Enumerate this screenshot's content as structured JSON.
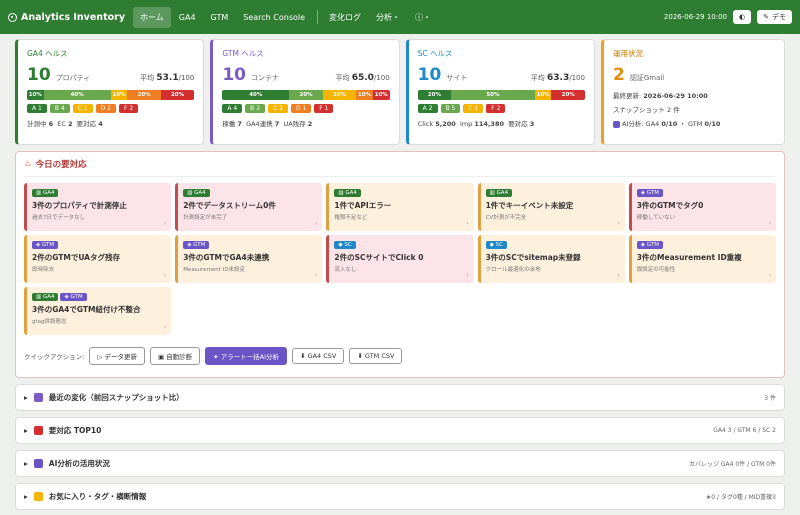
{
  "app": {
    "title": "Analytics Inventory",
    "nav": [
      "ホーム",
      "GA4",
      "GTM",
      "Search Console",
      "変化ログ",
      "分析・",
      "ⓘ・"
    ],
    "datetime": "2026-06-29 10:00",
    "demo": "デモ",
    "theme_icon": "◐"
  },
  "cards": [
    {
      "title": "GA4 ヘルス",
      "color": "#2e7d32",
      "count": "10",
      "unit": "プロパティ",
      "avg_label": "平均",
      "avg": "53.1",
      "avg_suffix": "/100",
      "bar": [
        {
          "label": "10%",
          "pct": 10,
          "color": "#2e7d32"
        },
        {
          "label": "40%",
          "pct": 40,
          "color": "#6aa84f"
        },
        {
          "label": "10%",
          "pct": 10,
          "color": "#f5b400"
        },
        {
          "label": "20%",
          "pct": 20,
          "color": "#ef7d22"
        },
        {
          "label": "20%",
          "pct": 20,
          "color": "#d32f2f"
        }
      ],
      "grades": [
        "A 1",
        "B 4",
        "C 1",
        "D 2",
        "F 2"
      ],
      "foot": [
        {
          "k": "計測中",
          "v": "6"
        },
        {
          "k": "EC",
          "v": "2"
        },
        {
          "k": "要対応",
          "v": "4"
        }
      ]
    },
    {
      "title": "GTM ヘルス",
      "color": "#7b5cc4",
      "count": "10",
      "unit": "コンテナ",
      "avg_label": "平均",
      "avg": "65.0",
      "avg_suffix": "/100",
      "bar": [
        {
          "label": "40%",
          "pct": 40,
          "color": "#2e7d32"
        },
        {
          "label": "20%",
          "pct": 20,
          "color": "#6aa84f"
        },
        {
          "label": "20%",
          "pct": 20,
          "color": "#f5b400"
        },
        {
          "label": "10%",
          "pct": 10,
          "color": "#ef7d22"
        },
        {
          "label": "10%",
          "pct": 10,
          "color": "#d32f2f"
        }
      ],
      "grades": [
        "A 4",
        "B 2",
        "C 2",
        "D 1",
        "F 1"
      ],
      "foot": [
        {
          "k": "稼働",
          "v": "7"
        },
        {
          "k": "GA4連携",
          "v": "7"
        },
        {
          "k": "UA残存",
          "v": "2"
        }
      ]
    },
    {
      "title": "SC ヘルス",
      "color": "#1e88c8",
      "count": "10",
      "unit": "サイト",
      "avg_label": "平均",
      "avg": "63.3",
      "avg_suffix": "/100",
      "bar": [
        {
          "label": "20%",
          "pct": 20,
          "color": "#2e7d32"
        },
        {
          "label": "50%",
          "pct": 50,
          "color": "#6aa84f"
        },
        {
          "label": "10%",
          "pct": 10,
          "color": "#f5b400"
        },
        {
          "label": "",
          "pct": 0,
          "color": "#ef7d22"
        },
        {
          "label": "20%",
          "pct": 20,
          "color": "#d32f2f"
        }
      ],
      "grades": [
        "A 2",
        "B 5",
        "C 1",
        "",
        "F 2"
      ],
      "foot": [
        {
          "k": "Click",
          "v": "5,200"
        },
        {
          "k": "Imp",
          "v": "114,380"
        },
        {
          "k": "要対応",
          "v": "3"
        }
      ]
    }
  ],
  "ops": {
    "title": "運用状況",
    "count": "2",
    "unit": "認証Gmail",
    "updated_label": "最終更新:",
    "updated": "2026-06-29 10:00",
    "snap": "スナップショット 2 件",
    "ai_label": "AI分析: GA4",
    "ai_ga4": "0/10",
    "ai_gtm_label": "GTM",
    "ai_gtm": "0/10"
  },
  "alerts": {
    "title": "今日の要対応",
    "items": [
      {
        "tags": [
          "GA4"
        ],
        "title": "3件のプロパティで計測停止",
        "sub": "過去7日でデータなし",
        "tone": "pink"
      },
      {
        "tags": [
          "GA4"
        ],
        "title": "2件でデータストリーム0件",
        "sub": "計測設定が未完了",
        "tone": "pink"
      },
      {
        "tags": [
          "GA4"
        ],
        "title": "1件でAPIエラー",
        "sub": "権限不足など",
        "tone": "orange"
      },
      {
        "tags": [
          "GA4"
        ],
        "title": "1件でキーイベント未設定",
        "sub": "CV計測が不完全",
        "tone": "orange"
      },
      {
        "tags": [
          "GTM"
        ],
        "title": "3件のGTMでタグ0",
        "sub": "稼働していない",
        "tone": "pink"
      },
      {
        "tags": [
          "GTM"
        ],
        "title": "2件のGTMでUAタグ残存",
        "sub": "即時除去",
        "tone": "orange"
      },
      {
        "tags": [
          "GTM"
        ],
        "title": "3件のGTMでGA4未連携",
        "sub": "Measurement ID未設定",
        "tone": "orange"
      },
      {
        "tags": [
          "SC"
        ],
        "title": "2件のSCサイトでClick 0",
        "sub": "流入なし",
        "tone": "pink"
      },
      {
        "tags": [
          "SC"
        ],
        "title": "3件のSCでsitemap未登録",
        "sub": "クロール最適化の余地",
        "tone": "orange"
      },
      {
        "tags": [
          "GTM"
        ],
        "title": "3件のMeasurement ID重複",
        "sub": "誤設定の可能性",
        "tone": "orange"
      },
      {
        "tags": [
          "GA4",
          "GTM"
        ],
        "title": "3件のGA4でGTM紐付け不整合",
        "sub": "gtag併設懸念",
        "tone": "orange"
      }
    ],
    "quick_label": "クイックアクション:",
    "actions": [
      "データ更新",
      "自動診断",
      "アラート一括AI分析",
      "GA4 CSV",
      "GTM CSV"
    ]
  },
  "sections": [
    {
      "title": "最近の変化（前回スナップショット比）",
      "right": "3 件",
      "icon": "#7b5cc4"
    },
    {
      "title": "要対応 TOP10",
      "right": "GA4 3 / GTM 6 / SC 2",
      "icon": "#d32f2f"
    },
    {
      "title": "AI分析の活用状況",
      "right": "カバレッジ GA4 0件 / GTM 0件",
      "icon": "#6a55c7"
    },
    {
      "title": "お気に入り・タグ・横断情報",
      "right": "★0 / タグ0種 / MID重複3",
      "icon": "#f5b400"
    }
  ]
}
